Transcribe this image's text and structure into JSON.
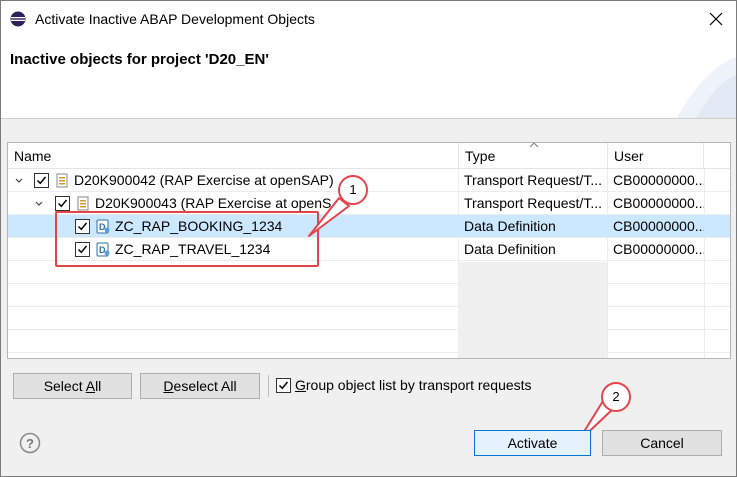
{
  "window": {
    "title": "Activate Inactive ABAP Development Objects",
    "app_icon": "eclipse-icon",
    "close_icon": "close-icon"
  },
  "banner": {
    "heading": "Inactive objects for project 'D20_EN'"
  },
  "table": {
    "columns": [
      "Name",
      "Type",
      "User"
    ],
    "rows": [
      {
        "name": "D20K900042 (RAP Exercise at openSAP)",
        "type": "Transport Request/T...",
        "user": "CB00000000...",
        "level": 0,
        "expanded": true,
        "checked": true,
        "icon": "transport-request-icon",
        "selected": false
      },
      {
        "name": "D20K900043 (RAP Exercise at openS...",
        "type": "Transport Request/T...",
        "user": "CB00000000...",
        "level": 1,
        "expanded": true,
        "checked": true,
        "icon": "transport-task-icon",
        "selected": false
      },
      {
        "name": "ZC_RAP_BOOKING_1234",
        "type": "Data Definition",
        "user": "CB00000000...",
        "level": 2,
        "expanded": false,
        "checked": true,
        "icon": "data-definition-icon",
        "selected": true
      },
      {
        "name": "ZC_RAP_TRAVEL_1234",
        "type": "Data Definition",
        "user": "CB00000000...",
        "level": 2,
        "expanded": false,
        "checked": true,
        "icon": "data-definition-icon",
        "selected": false
      }
    ]
  },
  "annotations": {
    "callout_1": "1",
    "callout_2": "2",
    "color": "#e4444a"
  },
  "controls": {
    "select_all_prefix": "Select ",
    "select_all_underlined": "A",
    "select_all_suffix": "ll",
    "deselect_all_prefix": "",
    "deselect_all_underlined": "D",
    "deselect_all_suffix": "eselect All",
    "group_checkbox_checked": true,
    "group_label_underlined": "G",
    "group_label_suffix": "roup object list by transport requests",
    "activate_label": "Activate",
    "cancel_label": "Cancel",
    "help_icon": "help-icon"
  },
  "colors": {
    "selection": "#cce8ff",
    "default_button_border": "#0078d7"
  }
}
